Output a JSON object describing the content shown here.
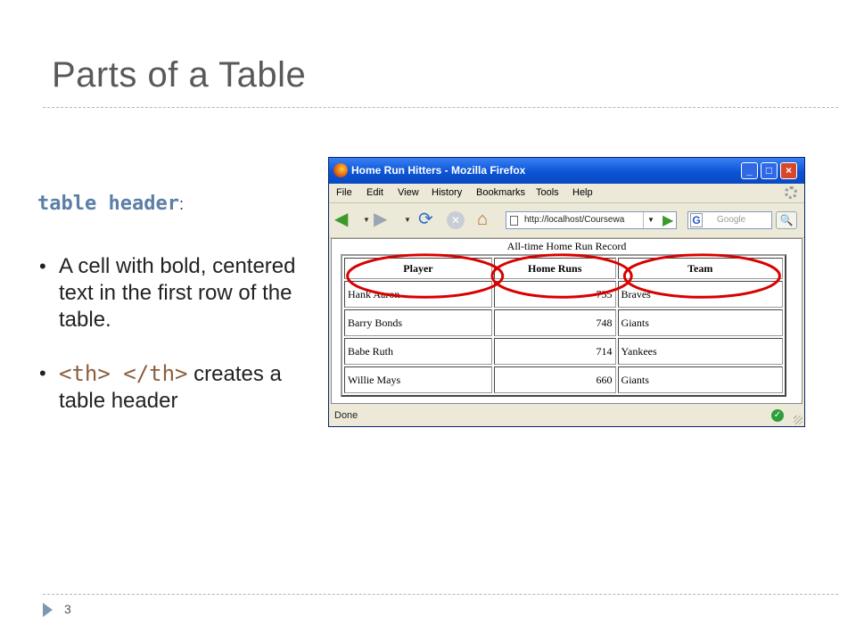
{
  "slide": {
    "title": "Parts of a Table",
    "heading": "table header",
    "heading_colon": ":",
    "bullets": [
      {
        "marker": "•",
        "text": "A cell with bold, centered text in the first row of the table."
      },
      {
        "marker": "•",
        "code": "<th> </th>",
        "text": "creates a table header"
      }
    ],
    "page_number": "3"
  },
  "browser": {
    "window_title": "Home Run Hitters - Mozilla Firefox",
    "menu": [
      "File",
      "Edit",
      "View",
      "History",
      "Bookmarks",
      "Tools",
      "Help"
    ],
    "url": "http://localhost/Coursewa",
    "search_placeholder": "Google",
    "search_engine_letter": "G",
    "status": "Done",
    "icons": [
      "firefox-icon",
      "back-icon",
      "forward-icon",
      "reload-icon",
      "stop-icon",
      "home-icon",
      "go-icon",
      "search-icon",
      "status-ok-icon"
    ]
  },
  "table": {
    "caption": "All-time Home Run Record",
    "headers": [
      "Player",
      "Home Runs",
      "Team"
    ],
    "rows": [
      [
        "Hank Aaron",
        "755",
        "Braves"
      ],
      [
        "Barry Bonds",
        "748",
        "Giants"
      ],
      [
        "Babe Ruth",
        "714",
        "Yankees"
      ],
      [
        "Willie Mays",
        "660",
        "Giants"
      ]
    ]
  },
  "colors": {
    "title_text": "#595959",
    "heading_text": "#5b7fa6",
    "highlight_oval": "#d90000",
    "titlebar": "#0b54d6"
  }
}
